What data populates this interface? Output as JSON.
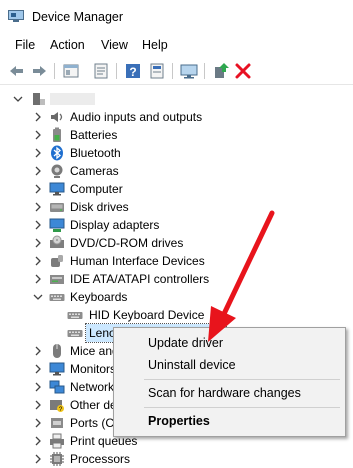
{
  "window": {
    "title": "Device Manager"
  },
  "menu": [
    "File",
    "Action",
    "View",
    "Help"
  ],
  "toolbar": {
    "buttons": [
      "back-icon",
      "forward-icon",
      "properties-icon",
      "update-driver-icon",
      "help-icon",
      "scan-icon",
      "monitor-icon",
      "enable-device-icon",
      "uninstall-x-icon"
    ]
  },
  "tree": {
    "root_label": "",
    "categories": [
      {
        "label": "Audio inputs and outputs",
        "icon": "speaker-icon"
      },
      {
        "label": "Batteries",
        "icon": "battery-icon"
      },
      {
        "label": "Bluetooth",
        "icon": "bluetooth-icon"
      },
      {
        "label": "Cameras",
        "icon": "camera-icon"
      },
      {
        "label": "Computer",
        "icon": "computer-icon"
      },
      {
        "label": "Disk drives",
        "icon": "disk-icon"
      },
      {
        "label": "Display adapters",
        "icon": "display-adapter-icon"
      },
      {
        "label": "DVD/CD-ROM drives",
        "icon": "dvd-icon"
      },
      {
        "label": "Human Interface Devices",
        "icon": "hid-icon"
      },
      {
        "label": "IDE ATA/ATAPI controllers",
        "icon": "ide-icon"
      },
      {
        "label": "Keyboards",
        "icon": "keyboard-icon",
        "expanded": true
      },
      {
        "label": "Mice and other pointing devices",
        "icon": "mouse-icon"
      },
      {
        "label": "Monitors",
        "icon": "monitor-icon"
      },
      {
        "label": "Network adapters",
        "icon": "network-icon"
      },
      {
        "label": "Other devices",
        "icon": "other-devices-icon"
      },
      {
        "label": "Ports (COM & LPT)",
        "icon": "port-icon"
      },
      {
        "label": "Print queues",
        "icon": "printer-icon"
      },
      {
        "label": "Processors",
        "icon": "processor-icon"
      }
    ],
    "keyboards_children": [
      {
        "label": "HID Keyboard Device"
      },
      {
        "label": "Lenovo Keyboard Device",
        "selected": true
      }
    ]
  },
  "context_menu": {
    "items": [
      "Update driver",
      "Uninstall device",
      "Scan for hardware changes",
      "Properties"
    ],
    "default_item": "Properties"
  },
  "colors": {
    "selection": "#cce8ff",
    "arrow": "#e8141c",
    "uninstall_x": "#e81123"
  }
}
